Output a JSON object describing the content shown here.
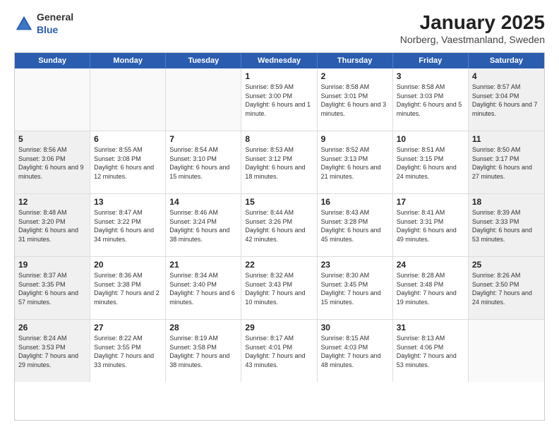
{
  "header": {
    "logo": {
      "general": "General",
      "blue": "Blue"
    },
    "title": "January 2025",
    "subtitle": "Norberg, Vaestmanland, Sweden"
  },
  "weekdays": [
    "Sunday",
    "Monday",
    "Tuesday",
    "Wednesday",
    "Thursday",
    "Friday",
    "Saturday"
  ],
  "weeks": [
    [
      {
        "day": "",
        "empty": true
      },
      {
        "day": "",
        "empty": true
      },
      {
        "day": "",
        "empty": true
      },
      {
        "day": "1",
        "sunrise": "Sunrise: 8:59 AM",
        "sunset": "Sunset: 3:00 PM",
        "daylight": "Daylight: 6 hours and 1 minute."
      },
      {
        "day": "2",
        "sunrise": "Sunrise: 8:58 AM",
        "sunset": "Sunset: 3:01 PM",
        "daylight": "Daylight: 6 hours and 3 minutes."
      },
      {
        "day": "3",
        "sunrise": "Sunrise: 8:58 AM",
        "sunset": "Sunset: 3:03 PM",
        "daylight": "Daylight: 6 hours and 5 minutes."
      },
      {
        "day": "4",
        "sunrise": "Sunrise: 8:57 AM",
        "sunset": "Sunset: 3:04 PM",
        "daylight": "Daylight: 6 hours and 7 minutes."
      }
    ],
    [
      {
        "day": "5",
        "sunrise": "Sunrise: 8:56 AM",
        "sunset": "Sunset: 3:06 PM",
        "daylight": "Daylight: 6 hours and 9 minutes."
      },
      {
        "day": "6",
        "sunrise": "Sunrise: 8:55 AM",
        "sunset": "Sunset: 3:08 PM",
        "daylight": "Daylight: 6 hours and 12 minutes."
      },
      {
        "day": "7",
        "sunrise": "Sunrise: 8:54 AM",
        "sunset": "Sunset: 3:10 PM",
        "daylight": "Daylight: 6 hours and 15 minutes."
      },
      {
        "day": "8",
        "sunrise": "Sunrise: 8:53 AM",
        "sunset": "Sunset: 3:12 PM",
        "daylight": "Daylight: 6 hours and 18 minutes."
      },
      {
        "day": "9",
        "sunrise": "Sunrise: 8:52 AM",
        "sunset": "Sunset: 3:13 PM",
        "daylight": "Daylight: 6 hours and 21 minutes."
      },
      {
        "day": "10",
        "sunrise": "Sunrise: 8:51 AM",
        "sunset": "Sunset: 3:15 PM",
        "daylight": "Daylight: 6 hours and 24 minutes."
      },
      {
        "day": "11",
        "sunrise": "Sunrise: 8:50 AM",
        "sunset": "Sunset: 3:17 PM",
        "daylight": "Daylight: 6 hours and 27 minutes."
      }
    ],
    [
      {
        "day": "12",
        "sunrise": "Sunrise: 8:48 AM",
        "sunset": "Sunset: 3:20 PM",
        "daylight": "Daylight: 6 hours and 31 minutes."
      },
      {
        "day": "13",
        "sunrise": "Sunrise: 8:47 AM",
        "sunset": "Sunset: 3:22 PM",
        "daylight": "Daylight: 6 hours and 34 minutes."
      },
      {
        "day": "14",
        "sunrise": "Sunrise: 8:46 AM",
        "sunset": "Sunset: 3:24 PM",
        "daylight": "Daylight: 6 hours and 38 minutes."
      },
      {
        "day": "15",
        "sunrise": "Sunrise: 8:44 AM",
        "sunset": "Sunset: 3:26 PM",
        "daylight": "Daylight: 6 hours and 42 minutes."
      },
      {
        "day": "16",
        "sunrise": "Sunrise: 8:43 AM",
        "sunset": "Sunset: 3:28 PM",
        "daylight": "Daylight: 6 hours and 45 minutes."
      },
      {
        "day": "17",
        "sunrise": "Sunrise: 8:41 AM",
        "sunset": "Sunset: 3:31 PM",
        "daylight": "Daylight: 6 hours and 49 minutes."
      },
      {
        "day": "18",
        "sunrise": "Sunrise: 8:39 AM",
        "sunset": "Sunset: 3:33 PM",
        "daylight": "Daylight: 6 hours and 53 minutes."
      }
    ],
    [
      {
        "day": "19",
        "sunrise": "Sunrise: 8:37 AM",
        "sunset": "Sunset: 3:35 PM",
        "daylight": "Daylight: 6 hours and 57 minutes."
      },
      {
        "day": "20",
        "sunrise": "Sunrise: 8:36 AM",
        "sunset": "Sunset: 3:38 PM",
        "daylight": "Daylight: 7 hours and 2 minutes."
      },
      {
        "day": "21",
        "sunrise": "Sunrise: 8:34 AM",
        "sunset": "Sunset: 3:40 PM",
        "daylight": "Daylight: 7 hours and 6 minutes."
      },
      {
        "day": "22",
        "sunrise": "Sunrise: 8:32 AM",
        "sunset": "Sunset: 3:43 PM",
        "daylight": "Daylight: 7 hours and 10 minutes."
      },
      {
        "day": "23",
        "sunrise": "Sunrise: 8:30 AM",
        "sunset": "Sunset: 3:45 PM",
        "daylight": "Daylight: 7 hours and 15 minutes."
      },
      {
        "day": "24",
        "sunrise": "Sunrise: 8:28 AM",
        "sunset": "Sunset: 3:48 PM",
        "daylight": "Daylight: 7 hours and 19 minutes."
      },
      {
        "day": "25",
        "sunrise": "Sunrise: 8:26 AM",
        "sunset": "Sunset: 3:50 PM",
        "daylight": "Daylight: 7 hours and 24 minutes."
      }
    ],
    [
      {
        "day": "26",
        "sunrise": "Sunrise: 8:24 AM",
        "sunset": "Sunset: 3:53 PM",
        "daylight": "Daylight: 7 hours and 29 minutes."
      },
      {
        "day": "27",
        "sunrise": "Sunrise: 8:22 AM",
        "sunset": "Sunset: 3:55 PM",
        "daylight": "Daylight: 7 hours and 33 minutes."
      },
      {
        "day": "28",
        "sunrise": "Sunrise: 8:19 AM",
        "sunset": "Sunset: 3:58 PM",
        "daylight": "Daylight: 7 hours and 38 minutes."
      },
      {
        "day": "29",
        "sunrise": "Sunrise: 8:17 AM",
        "sunset": "Sunset: 4:01 PM",
        "daylight": "Daylight: 7 hours and 43 minutes."
      },
      {
        "day": "30",
        "sunrise": "Sunrise: 8:15 AM",
        "sunset": "Sunset: 4:03 PM",
        "daylight": "Daylight: 7 hours and 48 minutes."
      },
      {
        "day": "31",
        "sunrise": "Sunrise: 8:13 AM",
        "sunset": "Sunset: 4:06 PM",
        "daylight": "Daylight: 7 hours and 53 minutes."
      },
      {
        "day": "",
        "empty": true
      }
    ]
  ]
}
